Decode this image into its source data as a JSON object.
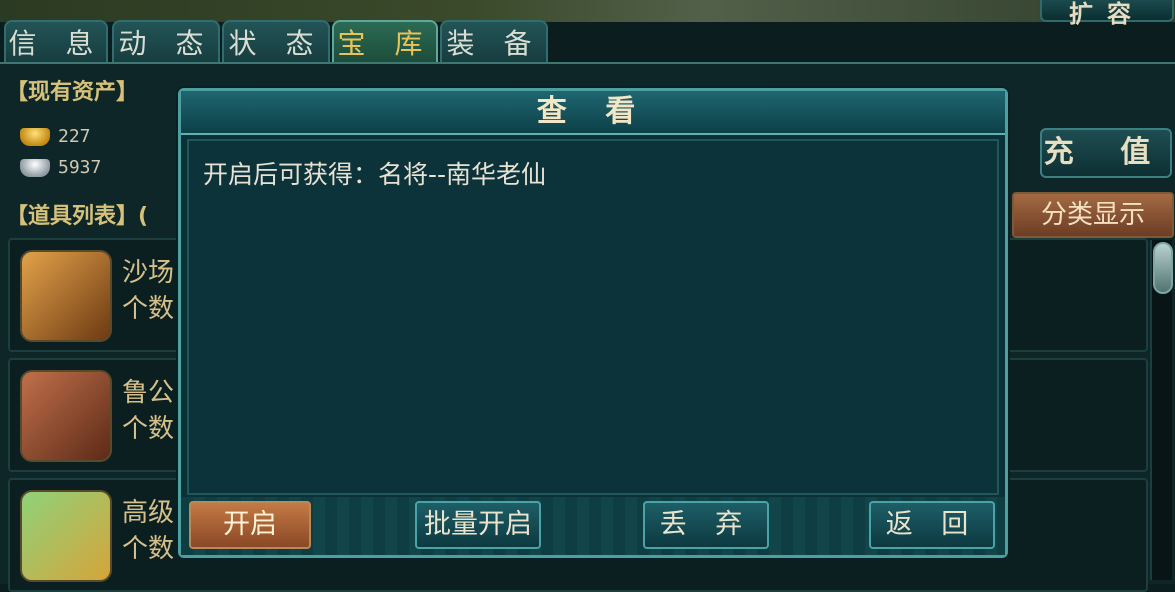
{
  "header": {
    "top_button_label": "扩容"
  },
  "tabs": [
    {
      "label": "信 息"
    },
    {
      "label": "动 态"
    },
    {
      "label": "状 态"
    },
    {
      "label": "宝 库",
      "active": true
    },
    {
      "label": "装 备"
    }
  ],
  "assets": {
    "title": "【现有资产】",
    "gold": "227",
    "silver": "5937",
    "recharge_label": "充 值"
  },
  "items": {
    "title": "【道具列表】(",
    "classify_label": "分类显示",
    "list": [
      {
        "name": "沙场",
        "count": "个数",
        "icon": "battlefield-icon"
      },
      {
        "name": "鲁公",
        "count": "个数",
        "icon": "scroll-icon"
      },
      {
        "name": "高级",
        "count": "个数",
        "icon": "drum-icon"
      }
    ]
  },
  "dialog": {
    "title": "查 看",
    "text": "开启后可获得：名将--南华老仙",
    "buttons": {
      "open": "开启",
      "batch_open": "批量开启",
      "discard": "丢 弃",
      "back": "返 回"
    }
  },
  "colors": {
    "accent_gold": "#e8c35a",
    "panel_bg": "#0e2628",
    "dialog_bg": "#0b3138",
    "primary_button": "#c47a45"
  }
}
